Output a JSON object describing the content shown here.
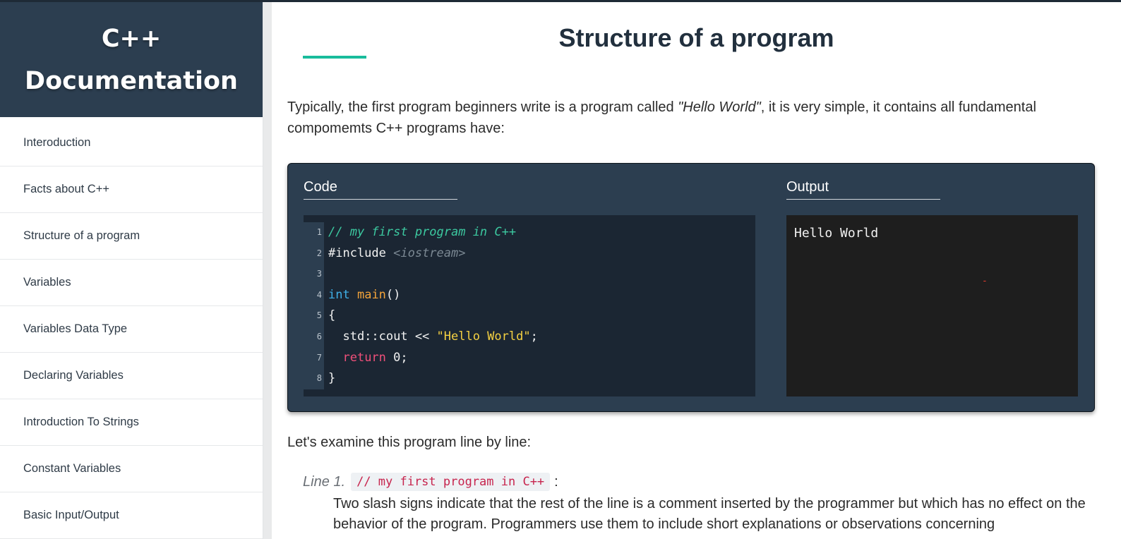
{
  "sidebar": {
    "title": "C++ Documentation",
    "items": [
      {
        "label": "Interoduction"
      },
      {
        "label": "Facts about C++"
      },
      {
        "label": "Structure of a program"
      },
      {
        "label": "Variables"
      },
      {
        "label": "Variables Data Type"
      },
      {
        "label": "Declaring Variables"
      },
      {
        "label": "Introduction To Strings"
      },
      {
        "label": "Constant Variables"
      },
      {
        "label": "Basic Input/Output"
      }
    ]
  },
  "main": {
    "title": "Structure of a program",
    "intro": {
      "before": "Typically, the first program beginners write is a program called ",
      "emphasis": "\"Hello World\"",
      "after": ", it is very simple, it contains all fundamental compomemts C++ programs have:"
    },
    "code_panel": {
      "code_heading": "Code",
      "output_heading": "Output",
      "lines": [
        {
          "n": "1",
          "tokens": [
            {
              "t": "// my first program in C++",
              "c": "comment"
            }
          ]
        },
        {
          "n": "2",
          "tokens": [
            {
              "t": "#include ",
              "c": "include"
            },
            {
              "t": "<iostream>",
              "c": "header"
            }
          ]
        },
        {
          "n": "3",
          "tokens": []
        },
        {
          "n": "4",
          "tokens": [
            {
              "t": "int",
              "c": "type"
            },
            {
              "t": " ",
              "c": "plain"
            },
            {
              "t": "main",
              "c": "func"
            },
            {
              "t": "()",
              "c": "plain"
            }
          ]
        },
        {
          "n": "5",
          "tokens": [
            {
              "t": "{",
              "c": "plain"
            }
          ]
        },
        {
          "n": "6",
          "tokens": [
            {
              "t": "  std::cout << ",
              "c": "plain"
            },
            {
              "t": "\"Hello World\"",
              "c": "str"
            },
            {
              "t": ";",
              "c": "plain"
            }
          ]
        },
        {
          "n": "7",
          "tokens": [
            {
              "t": "  ",
              "c": "plain"
            },
            {
              "t": "return",
              "c": "kw"
            },
            {
              "t": " 0;",
              "c": "plain"
            }
          ]
        },
        {
          "n": "8",
          "tokens": [
            {
              "t": "}",
              "c": "plain"
            }
          ]
        }
      ],
      "output_text": "Hello World",
      "output_marker": "-"
    },
    "examine_text": "Let's examine this program line by line:",
    "line_explanations": [
      {
        "label": "Line 1.",
        "code": "// my first program in C++",
        "colon": ":",
        "text": "Two slash signs indicate that the rest of the line is a comment inserted by the programmer but which has no effect on the behavior of the program. Programmers use them to include short explanations or observations concerning"
      }
    ]
  },
  "colors": {
    "sidebar_header": "#2c3e50",
    "accent": "#1abc9c",
    "code_panel": "#2c3e50",
    "code_bg": "#1b2633",
    "output_bg": "#1e1e1e",
    "inline_code": "#c7254e"
  }
}
